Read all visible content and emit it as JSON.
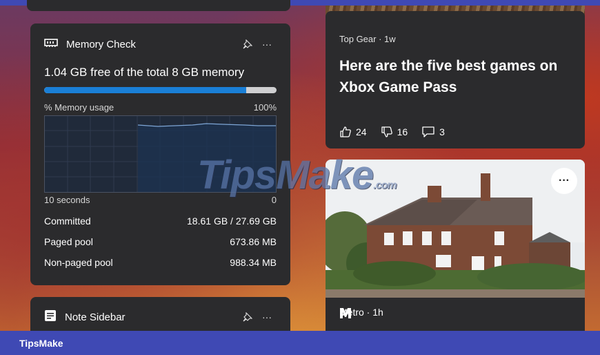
{
  "memory_widget": {
    "title": "Memory Check",
    "icon": "memory-chip-icon",
    "free_text": "1.04 GB free of the total 8 GB memory",
    "usage_fraction": 0.87,
    "graph_label": "% Memory usage",
    "graph_max_label": "100%",
    "axis_left": "10 seconds",
    "axis_right": "0",
    "stats": [
      {
        "label": "Committed",
        "value": "18.61 GB / 27.69 GB"
      },
      {
        "label": "Paged pool",
        "value": "673.86 MB"
      },
      {
        "label": "Non-paged pool",
        "value": "988.34 MB"
      }
    ],
    "colors": {
      "bar_fill": "#1a7fd6",
      "bar_track": "#cfcfd1"
    }
  },
  "note_widget": {
    "title": "Note Sidebar",
    "icon": "note-icon"
  },
  "article": {
    "source": "Top Gear · 1w",
    "headline": "Here are the five best games on Xbox Game Pass",
    "likes": "24",
    "dislikes": "16",
    "comments": "3"
  },
  "photo_article": {
    "source": "Metro · 1h",
    "more_label": "···"
  },
  "watermark": {
    "text": "TipsMake",
    "suffix": ".com"
  },
  "footer": {
    "brand": "TipsMake"
  }
}
